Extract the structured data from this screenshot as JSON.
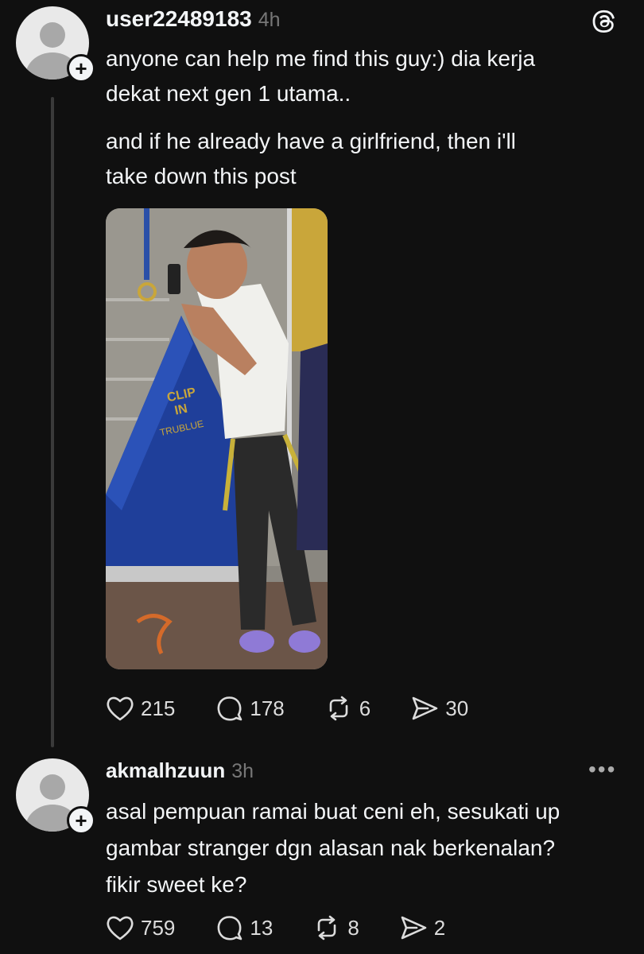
{
  "post": {
    "username": "user22489183",
    "time": "4h",
    "text_line1": "anyone can help me find this guy:) dia kerja",
    "text_line2": "dekat next gen 1 utama..",
    "text2_line1": "and if he already have a girlfriend, then i'll",
    "text2_line2": "take down this post",
    "image_text_1": "CLIP",
    "image_text_2": "IN",
    "image_text_3": "TRUBLUE",
    "likes": "215",
    "replies": "178",
    "reposts": "6",
    "shares": "30"
  },
  "reply": {
    "username": "akmalhzuun",
    "time": "3h",
    "text_line1": "asal pempuan ramai buat ceni eh, sesukati up",
    "text_line2": "gambar stranger dgn alasan nak berkenalan?",
    "text_line3": "fikir sweet ke?",
    "likes": "759",
    "replies": "13",
    "reposts": "8",
    "shares": "2"
  },
  "icons": {
    "logo": "threads-logo-icon",
    "like": "heart-icon",
    "reply": "comment-icon",
    "repost": "repost-icon",
    "share": "send-icon",
    "more": "more-icon",
    "follow": "plus-icon"
  },
  "colors": {
    "background": "#101010",
    "text": "#f3f5f7",
    "muted": "#777777",
    "avatar": "#e9e9e9"
  }
}
